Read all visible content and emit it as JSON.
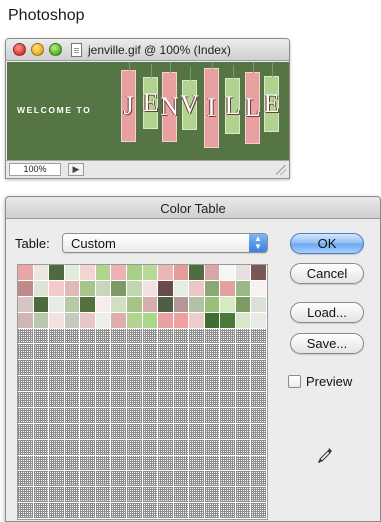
{
  "app": {
    "name": "Photoshop"
  },
  "document_window": {
    "title": "jenville.gif @ 100% (Index)",
    "image": {
      "welcome_text": "WELCOME TO",
      "letters": [
        "J",
        "E",
        "N",
        "V",
        "I",
        "L",
        "L",
        "E"
      ],
      "letter_colors": [
        "#e8a0a0",
        "#b2d38f",
        "#e8a0a0",
        "#b2d38f",
        "#e8a0a0",
        "#b2d38f",
        "#e8a0a0",
        "#b2d38f"
      ],
      "background_color": "#557545"
    },
    "status": {
      "zoom": "100%",
      "menu_icon": "status-menu-icon"
    }
  },
  "color_table_dialog": {
    "title": "Color Table",
    "table_label": "Table:",
    "table_select": {
      "value": "Custom"
    },
    "buttons": {
      "ok": "OK",
      "cancel": "Cancel",
      "load": "Load...",
      "save": "Save..."
    },
    "preview": {
      "label": "Preview",
      "checked": false
    },
    "eyedropper_icon": "eyedropper-icon",
    "swatches": {
      "columns": 16,
      "rows": 16,
      "filled_count": 64,
      "colors": [
        "#e8a6a6",
        "#e8e8df",
        "#4e6b3d",
        "#e2ebdc",
        "#f3d4d4",
        "#b1d38e",
        "#efb1b1",
        "#a8cf86",
        "#b8d89a",
        "#ebb5b5",
        "#e29c9c",
        "#4f6e3f",
        "#d9a5a5",
        "#f4f6f1",
        "#e7e0e0",
        "#7a5656",
        "#bf8a8a",
        "#dde4d6",
        "#f4c9c9",
        "#e0b9b9",
        "#a5c58b",
        "#c8d6bd",
        "#7d9966",
        "#c2d6b0",
        "#f2e1e1",
        "#6a4a4a",
        "#e5eee0",
        "#ecc5c5",
        "#8aa876",
        "#e1a1a1",
        "#9ab987",
        "#f8f1f1",
        "#d7c4c4",
        "#4f6b3e",
        "#e7ede2",
        "#b6c8a4",
        "#54703f",
        "#f7eded",
        "#d0e0c2",
        "#a7c486",
        "#d6aeae",
        "#4e5e45",
        "#b39696",
        "#b5c0a9",
        "#99be76",
        "#d7ebc3",
        "#7c9c63",
        "#dcdfd7",
        "#d1b5b5",
        "#b8c7ad",
        "#f3e0e0",
        "#c5ccbf",
        "#e9c6c6",
        "#ecefe9",
        "#ddaeae",
        "#b4d38f",
        "#a9d78c",
        "#e8a0a0",
        "#ee9f9f",
        "#eccccc",
        "#3e6e32",
        "#4a7a3a",
        "#d8e7cb",
        "#e7ebe3"
      ]
    }
  }
}
